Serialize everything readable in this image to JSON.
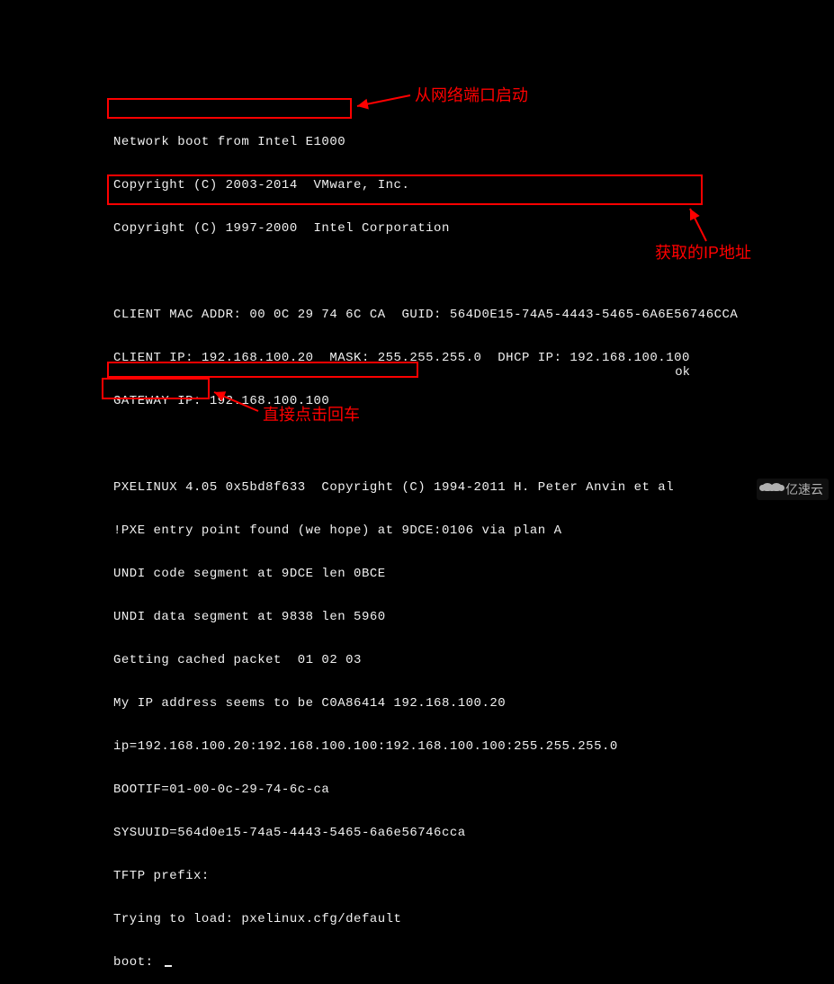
{
  "console": {
    "lines": [
      "Network boot from Intel E1000",
      "Copyright (C) 2003-2014  VMware, Inc.",
      "Copyright (C) 1997-2000  Intel Corporation",
      "",
      "CLIENT MAC ADDR: 00 0C 29 74 6C CA  GUID: 564D0E15-74A5-4443-5465-6A6E56746CCA",
      "CLIENT IP: 192.168.100.20  MASK: 255.255.255.0  DHCP IP: 192.168.100.100",
      "GATEWAY IP: 192.168.100.100",
      "",
      "PXELINUX 4.05 0x5bd8f633  Copyright (C) 1994-2011 H. Peter Anvin et al",
      "!PXE entry point found (we hope) at 9DCE:0106 via plan A",
      "UNDI code segment at 9DCE len 0BCE",
      "UNDI data segment at 9838 len 5960",
      "Getting cached packet  01 02 03",
      "My IP address seems to be C0A86414 192.168.100.20",
      "ip=192.168.100.20:192.168.100.100:192.168.100.100:255.255.255.0",
      "BOOTIF=01-00-0c-29-74-6c-ca",
      "SYSUUID=564d0e15-74a5-4443-5465-6a6e56746cca",
      "TFTP prefix:",
      "Trying to load: pxelinux.cfg/default"
    ],
    "boot_prompt": "boot: ",
    "status_ok": "ok"
  },
  "annotations": {
    "network_boot": "从网络端口启动",
    "ip_address": "获取的IP地址",
    "press_enter": "直接点击回车"
  },
  "watermark": {
    "text": "亿速云"
  }
}
